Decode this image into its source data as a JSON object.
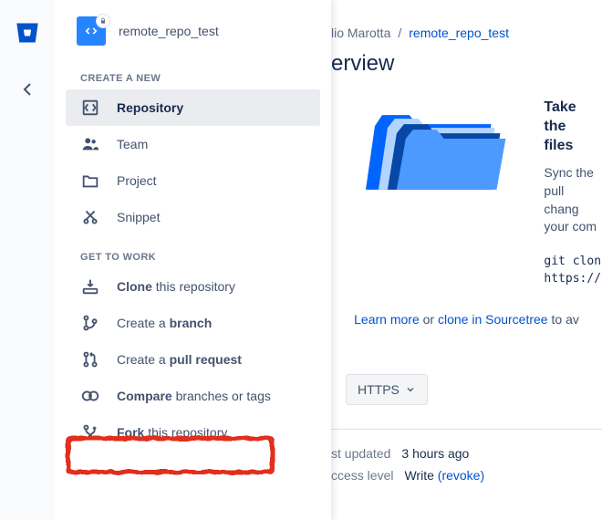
{
  "repo": {
    "name": "remote_repo_test"
  },
  "sections": {
    "create": {
      "title": "CREATE A NEW"
    },
    "work": {
      "title": "GET TO WORK"
    }
  },
  "menu": {
    "repository": "Repository",
    "team": "Team",
    "project": "Project",
    "snippet": "Snippet",
    "clone_prefix": "Clone",
    "clone_suffix": " this repository",
    "branch_prefix": "Create a ",
    "branch_bold": "branch",
    "pr_prefix": "Create a ",
    "pr_bold": "pull request",
    "compare_prefix": "Compare",
    "compare_suffix": " branches or tags",
    "fork_prefix": "Fork",
    "fork_suffix": " this repository"
  },
  "breadcrumb": {
    "owner": "lio Marotta",
    "sep": "/",
    "repo": "remote_repo_test"
  },
  "page": {
    "title_fragment": "erview"
  },
  "hero": {
    "heading": "Take the\nfiles",
    "body": "Sync the\npull chang\nyour com",
    "code": "git clon\nhttps://"
  },
  "learn": {
    "learn_more": "Learn more",
    "or": " or ",
    "clone_st": "clone in Sourcetree",
    "suffix": " to av"
  },
  "https": {
    "label": "HTTPS"
  },
  "details": {
    "last_updated_label": "st updated",
    "last_updated_value": "3 hours ago",
    "access_label": "ccess level",
    "access_value": "Write ",
    "revoke": "(revoke)"
  }
}
